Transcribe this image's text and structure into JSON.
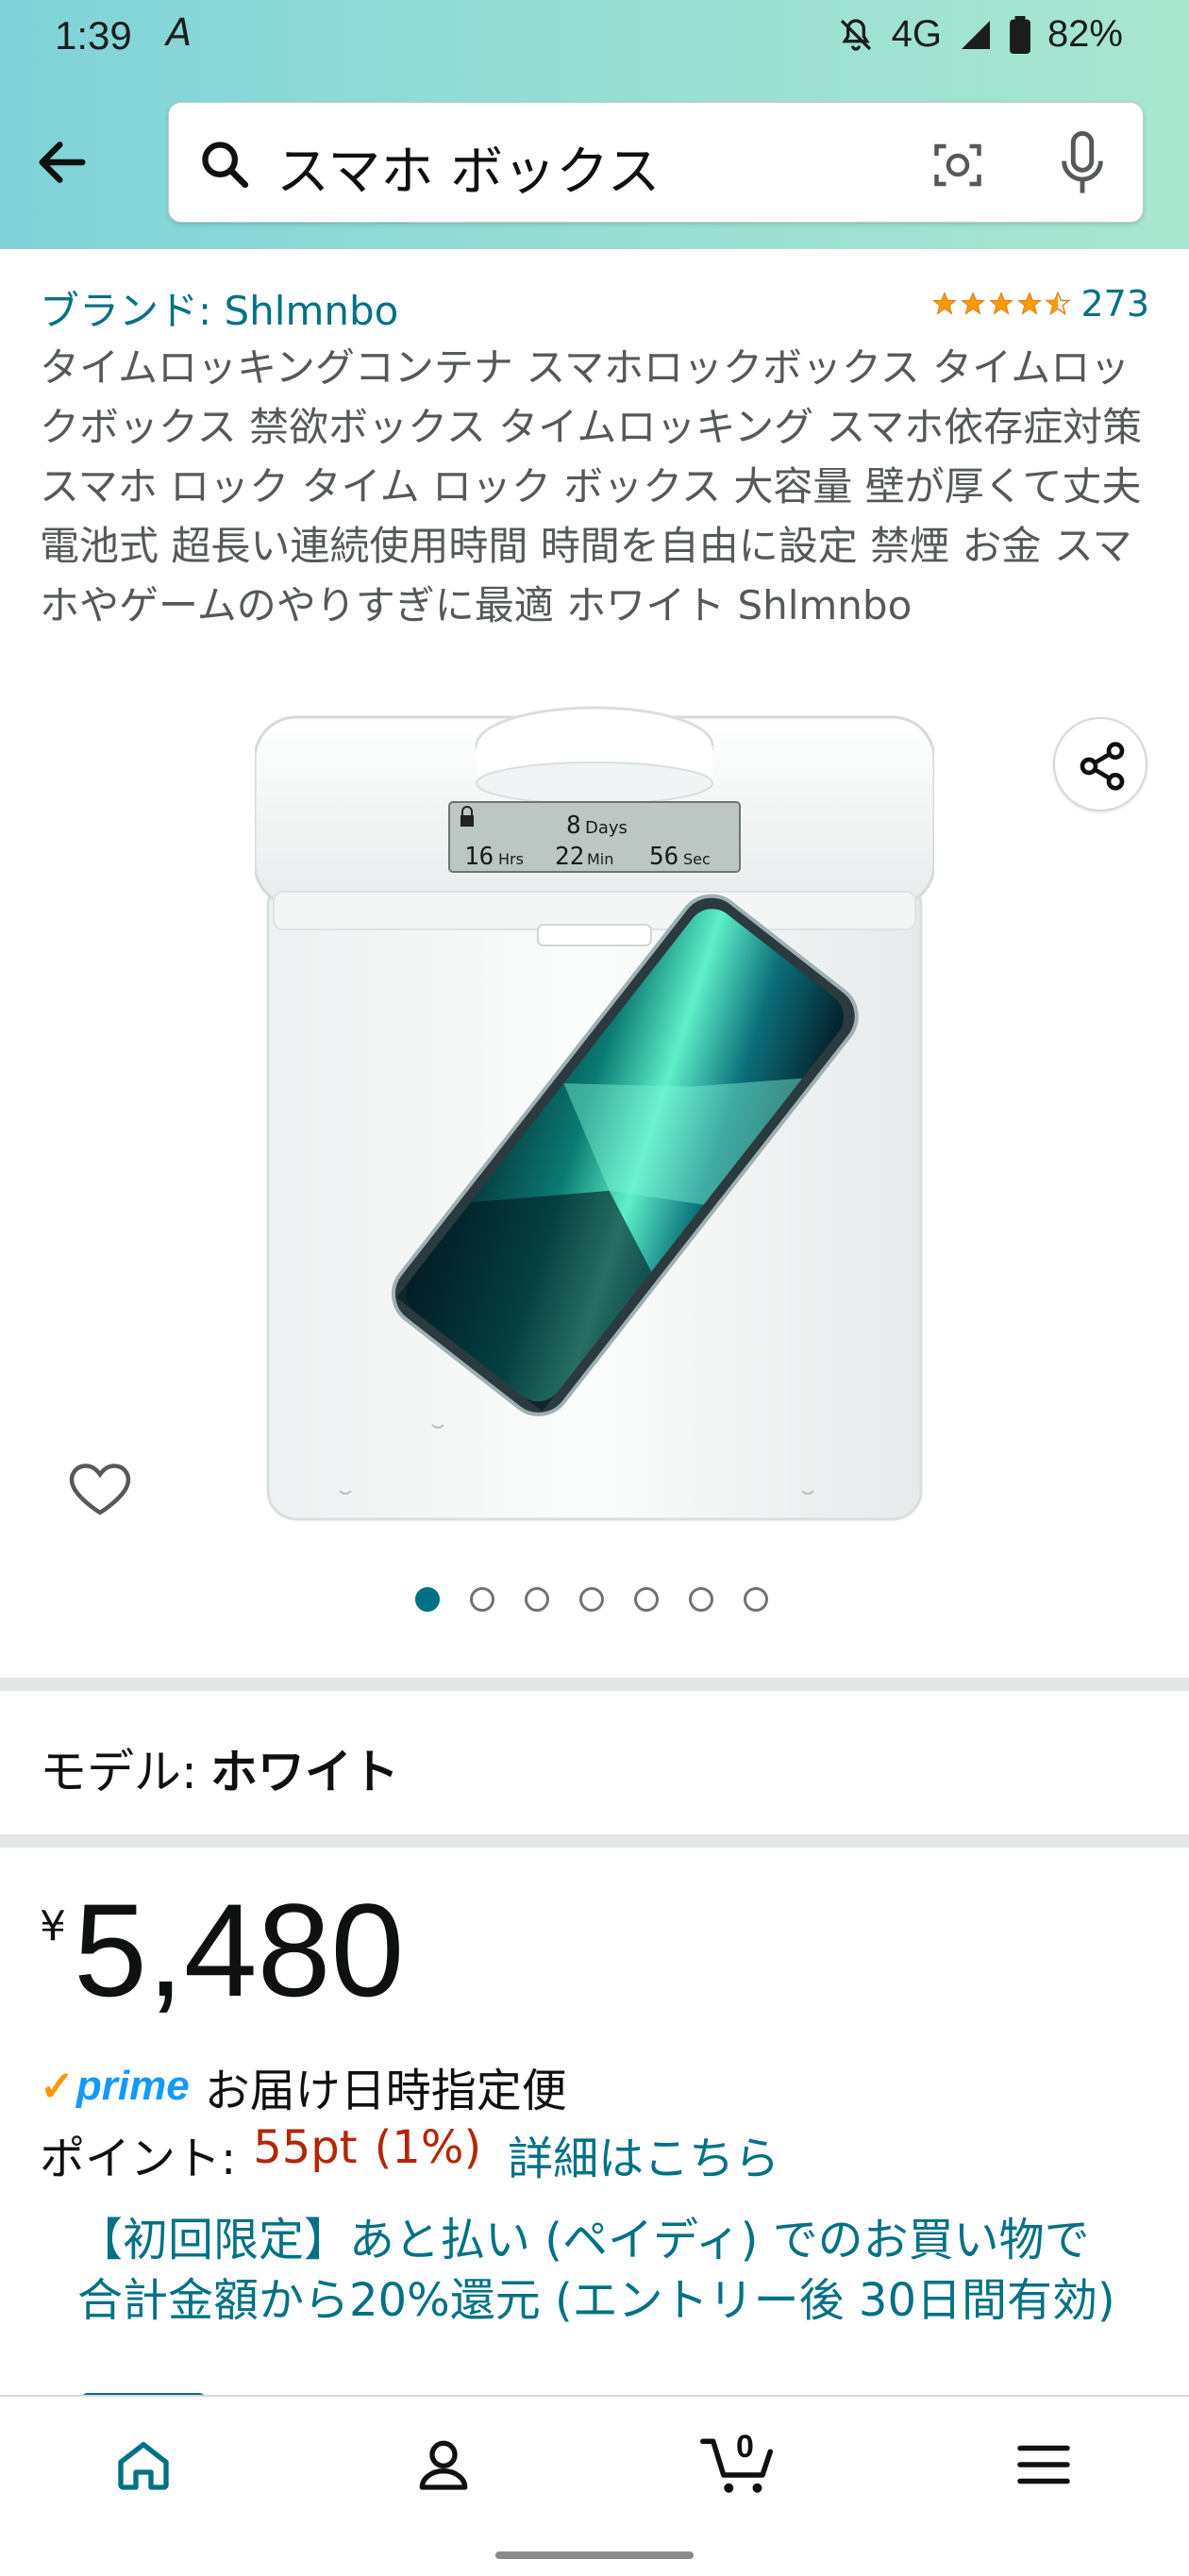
{
  "status_bar": {
    "time": "1:39",
    "network": "4G",
    "battery": "82%"
  },
  "search": {
    "query": "スマホ ボックス"
  },
  "product": {
    "brand": "ブランド: Shlmnbo",
    "rating": 4.5,
    "review_count": "273",
    "title": "タイムロッキングコンテナ スマホロックボックス タイムロックボックス 禁欲ボックス タイムロッキング スマホ依存症対策 スマホ ロック タイム ロック ボックス 大容量 壁が厚くて丈夫 電池式 超長い連続使用時間 時間を自由に設定 禁煙 お金 スマホやゲームのやりすぎに最適 ホワイト Shlmnbo",
    "lcd": {
      "days_value": "8",
      "days_unit": "Days",
      "hrs_value": "16",
      "hrs_unit": "Hrs",
      "min_value": "22",
      "min_unit": "Min",
      "sec_value": "56",
      "sec_unit": "Sec"
    },
    "image_count": 7,
    "active_image": 0
  },
  "model": {
    "label": "モデル:",
    "value": "ホワイト"
  },
  "price": {
    "currency": "¥",
    "amount": "5,480"
  },
  "prime": {
    "logo": "prime",
    "text": "お届け日時指定便"
  },
  "points": {
    "label": "ポイント:",
    "value": "55pt",
    "percent": "(1%)",
    "link": "詳細はこちら"
  },
  "promo": {
    "text": "【初回限定】あと払い (ペイディ) でのお買い物で合計金額から20%還元 (エントリー後 30日間有効)"
  },
  "bottom_nav": {
    "cart_count": "0"
  },
  "colors": {
    "link": "#007185",
    "price_red": "#b12704",
    "star": "#ff9900",
    "prime_blue": "#1399ff"
  }
}
